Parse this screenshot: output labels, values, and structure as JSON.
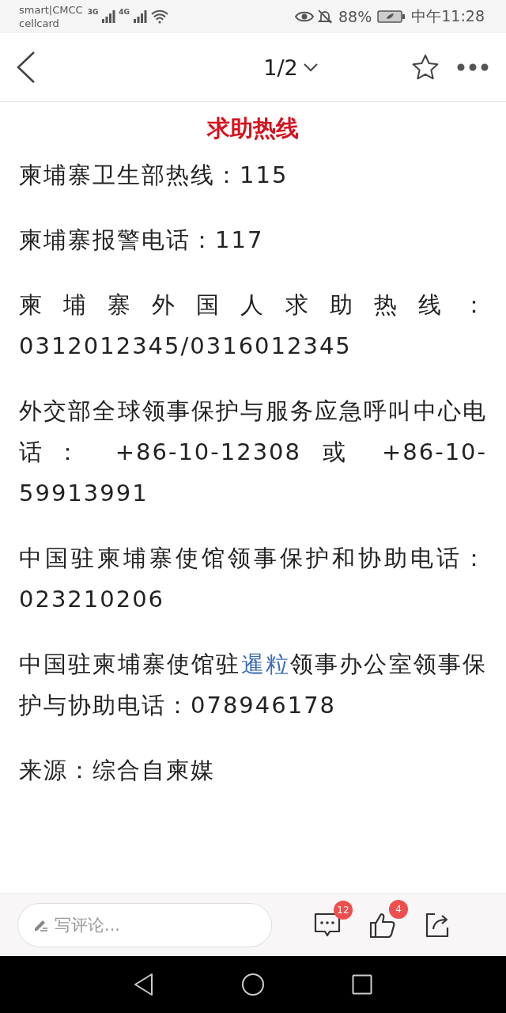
{
  "status_bar": {
    "carrier_line_1": "smart|CMCC",
    "carrier_line_2": "cellcard",
    "network_1": "3G",
    "network_2": "4G",
    "battery": "88%",
    "time": "中午11:28"
  },
  "header": {
    "page_indicator": "1/2"
  },
  "article": {
    "title": "求助热线",
    "paragraphs": [
      {
        "parts": [
          {
            "kind": "text",
            "text": "柬埔寨卫生部热线：115"
          }
        ]
      },
      {
        "parts": [
          {
            "kind": "text",
            "text": "柬埔寨报警电话：117"
          }
        ]
      },
      {
        "parts": [
          {
            "kind": "text",
            "text": "柬埔寨外国人求助热线：0312012345/0316012345"
          }
        ]
      },
      {
        "parts": [
          {
            "kind": "text",
            "text": "外交部全球领事保护与服务应急呼叫中心电话：  +86-10-12308 或 +86-10-59913991"
          }
        ]
      },
      {
        "parts": [
          {
            "kind": "text",
            "text": "中国驻柬埔寨使馆领事保护和协助电话：023210206"
          }
        ]
      },
      {
        "parts": [
          {
            "kind": "text",
            "text": "中国驻柬埔寨使馆驻"
          },
          {
            "kind": "link",
            "text": "暹粒"
          },
          {
            "kind": "text",
            "text": "领事办公室领事保护与协助电话：078946178"
          }
        ]
      },
      {
        "parts": [
          {
            "kind": "text",
            "text": "来源：综合自柬媒"
          }
        ]
      }
    ]
  },
  "comment_bar": {
    "placeholder": "写评论...",
    "comment_count": "12",
    "like_count": "4"
  }
}
